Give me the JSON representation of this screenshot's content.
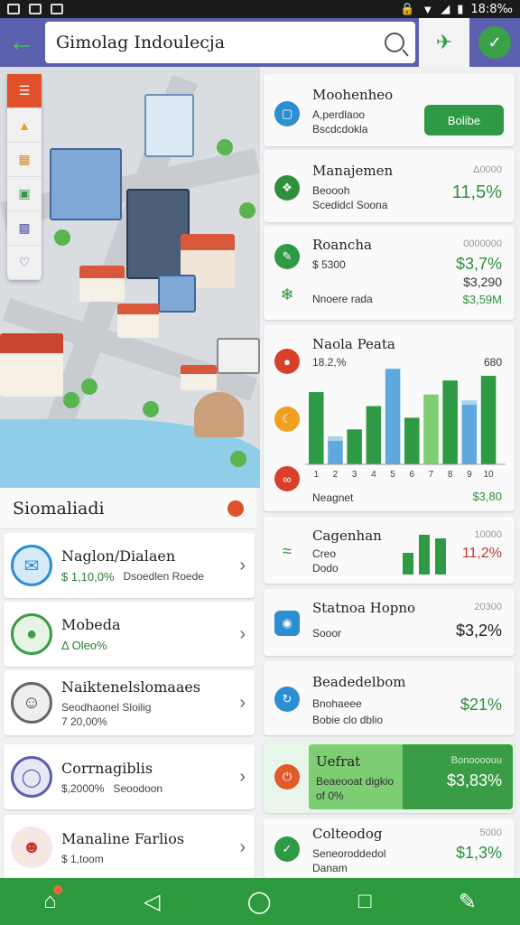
{
  "statusbar": {
    "time": "18:8‰",
    "left_icons": [
      "image-icon",
      "image-icon",
      "image-icon",
      "image-icon",
      "image-icon"
    ],
    "right_icons": [
      "lock-icon",
      "wifi-icon",
      "signal-icon",
      "battery-icon"
    ]
  },
  "appbar": {
    "back_icon": "back-arrow-icon",
    "search_text": "Gimolag Indoulecja",
    "action1_icon": "tag-notification-icon",
    "action2_icon": "check-circle-icon"
  },
  "map": {
    "tool_icons": [
      "layers-icon",
      "construction-icon",
      "grid-icon",
      "plan-icon",
      "buildings-icon",
      "heart-icon"
    ],
    "next_icon": "chevron-right-icon"
  },
  "left_panel": {
    "title": "Siomaliadi",
    "items": [
      {
        "title": "Naglon/Dialaen",
        "pct": "$ 1,10,0%",
        "note": "Dsoedlen Roede",
        "avatar": "mail-icon",
        "color": "#2b8fd1"
      },
      {
        "title": "Mobeda",
        "pct": "Δ Oleo%",
        "note": "",
        "avatar": "person-icon",
        "color": "#3a9c45"
      },
      {
        "title": "Naiktenelslomaaes",
        "pct": "7 20,00%",
        "note": "Seodhaonel Sloilig",
        "avatar": "person-icon",
        "color": "#666666"
      },
      {
        "title": "Corrnagiblis",
        "pct": "$,2000%",
        "note": "Seoodoon",
        "avatar": "globe-icon",
        "color": "#5a5fae"
      },
      {
        "title": "Manaline Farlios",
        "pct": "$ 1,toom",
        "note": "",
        "avatar": "person-icon",
        "color": "#c0392b"
      }
    ]
  },
  "right_panel": {
    "cards": [
      {
        "title": "Moohenheo",
        "line1": "A,perdlaoo",
        "line2": "Bscdcdokla",
        "button": "Bolibe",
        "icon": "folder-icon",
        "icon_color": "#2b8fd1"
      },
      {
        "title": "Manajemen",
        "line1": "Beoooh",
        "line2": "Scedidcl Soona",
        "small": "Δ0000",
        "value": "11,5%",
        "icon": "puzzle-icon",
        "icon_color": "#2f8f3a"
      },
      {
        "title": "Roancha",
        "line1": "$ 5300",
        "line2": "Nnoere rada",
        "small": "0000000",
        "value": "$3,7%",
        "value2": "$3,290",
        "value3": "$3,59M",
        "icon": "edit-icon",
        "icon_color": "#2f9a45"
      },
      {
        "title": "Naola Peata",
        "left_label": "18.2,%",
        "right_label": "680",
        "footer_left": "Neagnet",
        "footer_value": "$3,80",
        "icons": [
          "pin-icon",
          "moon-icon",
          "link-icon"
        ]
      },
      {
        "title": "Cagenhan",
        "line1": "Creo",
        "line2": "Dodo",
        "small": "10000",
        "value": "11,2%",
        "icon": "stairs-icon",
        "icon_color": "#2f8f3a"
      },
      {
        "title": "Statnoa Hopno",
        "line1": "Sooor",
        "small": "20300",
        "value": "$3,2%",
        "icon": "camera-icon",
        "icon_color": "#2b8fd1"
      },
      {
        "title": "Beadedelbom",
        "line1": "Bnohaeee",
        "line2": "Bobie clo dblio",
        "value": "$21%",
        "icon": "sync-icon",
        "icon_color": "#2b8fd1"
      },
      {
        "title": "Uefrat",
        "line1": "Beaeooat digkio",
        "line2": "of 0%",
        "small": "Bonoooouu",
        "value": "$3,83%",
        "icon": "power-icon",
        "icon_color": "#e05a2a"
      },
      {
        "title": "Colteodog",
        "line1": "Seneoroddedol",
        "line2": "Danam",
        "small": "5000",
        "value": "$1,3%",
        "icon": "check-icon",
        "icon_color": "#2f9a45"
      }
    ]
  },
  "chart_data": {
    "type": "bar",
    "categories": [
      "1",
      "2",
      "3",
      "4",
      "5",
      "6",
      "7",
      "8",
      "9",
      "10"
    ],
    "series": [
      {
        "values": [
          62,
          22,
          30,
          50,
          82,
          40,
          60,
          72,
          52,
          76
        ]
      },
      {
        "values": [
          0,
          24,
          0,
          0,
          0,
          0,
          0,
          0,
          55,
          0
        ]
      }
    ],
    "colors": [
      "#2f9a45",
      "#5ea8dd",
      "#7fcf72",
      "#a8d8e8"
    ],
    "tick_labels": [
      "1",
      "2",
      "3",
      "4",
      "5",
      "6",
      "7",
      "8",
      "9",
      "10"
    ]
  },
  "bottom_nav": {
    "icons": [
      "home-icon",
      "back-icon",
      "home-circle-icon",
      "recents-icon",
      "share-icon"
    ]
  }
}
